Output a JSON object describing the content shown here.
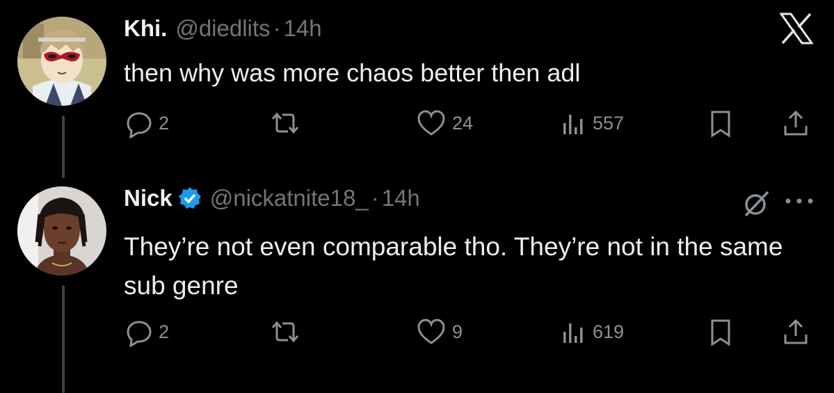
{
  "tweets": [
    {
      "name": "Khi.",
      "handle": "@diedlits",
      "separator": "·",
      "time": "14h",
      "text": "then why was more chaos better then adl",
      "verified": false,
      "replies": "2",
      "reposts": "",
      "likes": "24",
      "views": "557"
    },
    {
      "name": "Nick",
      "handle": "@nickatnite18_",
      "separator": "·",
      "time": "14h",
      "text": "They’re not even comparable tho. They’re not in the same sub genre",
      "verified": true,
      "replies": "2",
      "reposts": "",
      "likes": "9",
      "views": "619"
    }
  ],
  "icons": {
    "app_logo": "x-logo-icon",
    "reply": "reply-icon",
    "repost": "repost-icon",
    "like": "heart-icon",
    "views": "views-icon",
    "bookmark": "bookmark-icon",
    "share": "share-icon",
    "grok": "grok-icon",
    "more": "more-icon",
    "verified": "verified-badge-icon"
  },
  "colors": {
    "background": "#000000",
    "text": "#e7e9ea",
    "muted": "#71767b",
    "verified": "#1d9bf0",
    "thread_line": "#3e4144"
  }
}
